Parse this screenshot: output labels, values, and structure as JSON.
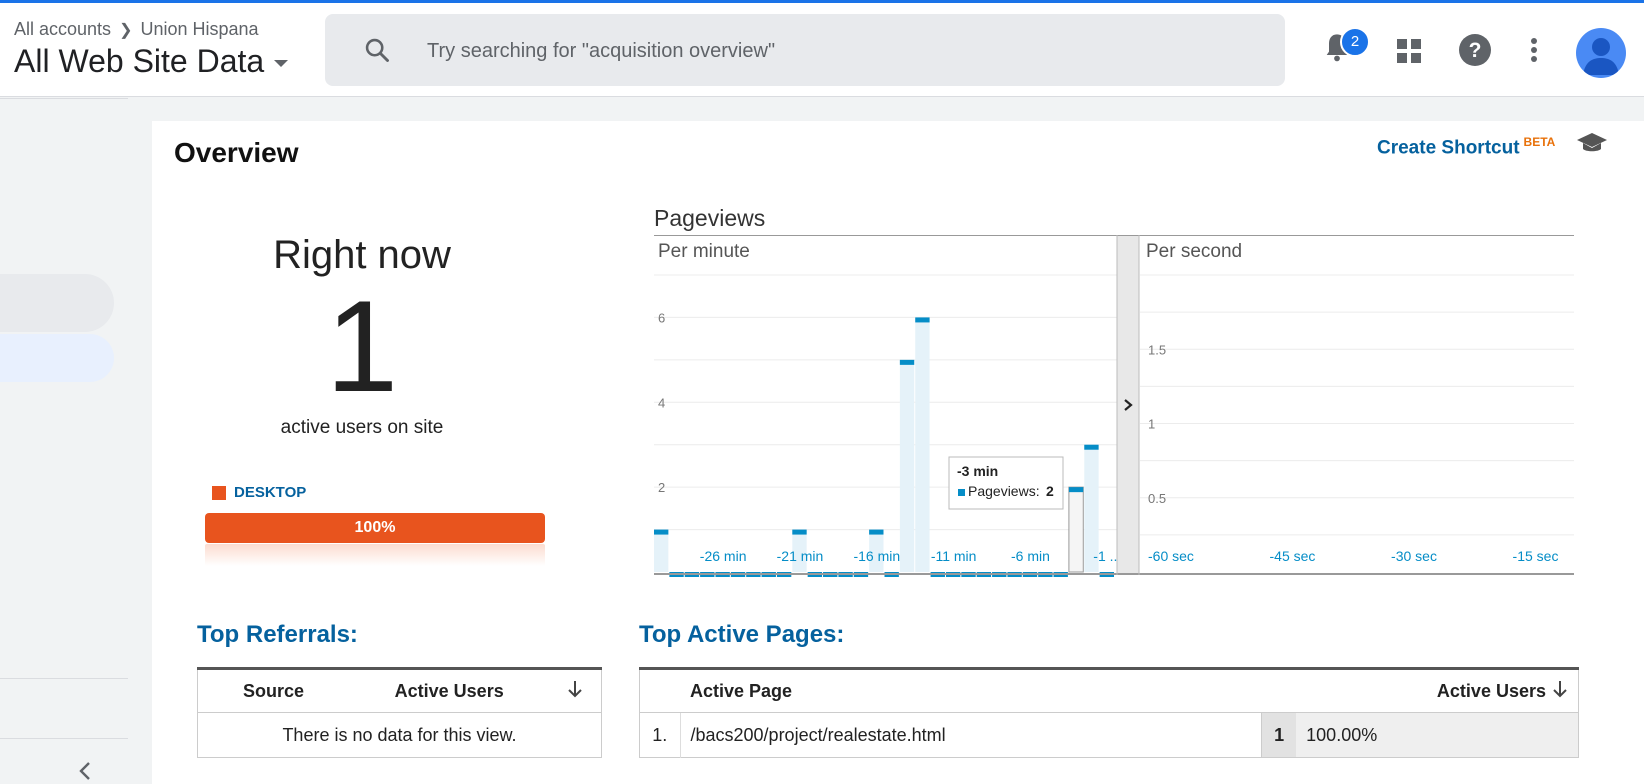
{
  "header": {
    "breadcrumb": {
      "account": "All accounts",
      "property": "Union Hispana"
    },
    "view_name": "All Web Site Data",
    "search": {
      "placeholder": "Try searching for \"acquisition overview\""
    },
    "notifications_count": "2",
    "icons": [
      "search-icon",
      "bell-icon",
      "apps-grid-icon",
      "help-icon",
      "more-vert-icon",
      "account-avatar-icon"
    ]
  },
  "page": {
    "title": "Overview",
    "create_shortcut": "Create Shortcut",
    "beta": "BETA"
  },
  "right_now": {
    "label": "Right now",
    "count": "1",
    "sub": "active users on site",
    "device": "DESKTOP",
    "device_pct_label": "100%",
    "device_share": 1.0,
    "device_color": "#e8541e"
  },
  "pageviews": {
    "title": "Pageviews",
    "per_minute_label": "Per minute",
    "per_second_label": "Per second",
    "tooltip": {
      "title": "-3 min",
      "series": "Pageviews:",
      "value": "2"
    }
  },
  "chart_data": [
    {
      "type": "bar",
      "title": "Per minute",
      "x_tick_labels": [
        "-26 min",
        "-21 min",
        "-16 min",
        "-11 min",
        "-6 min",
        "-1 ..."
      ],
      "ytick_labels": [
        "2",
        "4",
        "6"
      ],
      "ylim": [
        0,
        7
      ],
      "x": [
        -30,
        -29,
        -28,
        -27,
        -26,
        -25,
        -24,
        -23,
        -22,
        -21,
        -20,
        -19,
        -18,
        -17,
        -16,
        -15,
        -14,
        -13,
        -12,
        -11,
        -10,
        -9,
        -8,
        -7,
        -6,
        -5,
        -4,
        -3,
        -2,
        -1
      ],
      "values": [
        1,
        0,
        0,
        0,
        0,
        0,
        0,
        0,
        0,
        1,
        0,
        0,
        0,
        0,
        1,
        0,
        5,
        6,
        0,
        0,
        0,
        0,
        0,
        0,
        0,
        0,
        0,
        2,
        3,
        0
      ],
      "series": [
        {
          "name": "Pageviews",
          "color": "#058dc7"
        }
      ],
      "highlighted_bar": "-3 min"
    },
    {
      "type": "bar",
      "title": "Per second",
      "x_tick_labels": [
        "-60 sec",
        "-45 sec",
        "-30 sec",
        "-15 sec"
      ],
      "ytick_labels": [
        "0.5",
        "1",
        "1.5"
      ],
      "ylim": [
        0,
        2
      ],
      "values": []
    }
  ],
  "top_referrals": {
    "title": "Top Referrals:",
    "columns": [
      "Source",
      "Active Users"
    ],
    "empty_message": "There is no data for this view."
  },
  "top_pages": {
    "title": "Top Active Pages:",
    "columns": [
      "Active Page",
      "Active Users"
    ],
    "rows": [
      {
        "index": "1.",
        "page": "/bacs200/project/realestate.html",
        "users": "1",
        "pct": "100.00%"
      }
    ]
  },
  "colors": {
    "accent": "#1a73e8",
    "link": "#05619e",
    "device": "#e8541e",
    "bar": "#058dc7",
    "bar_fill": "#e5f2f9"
  }
}
